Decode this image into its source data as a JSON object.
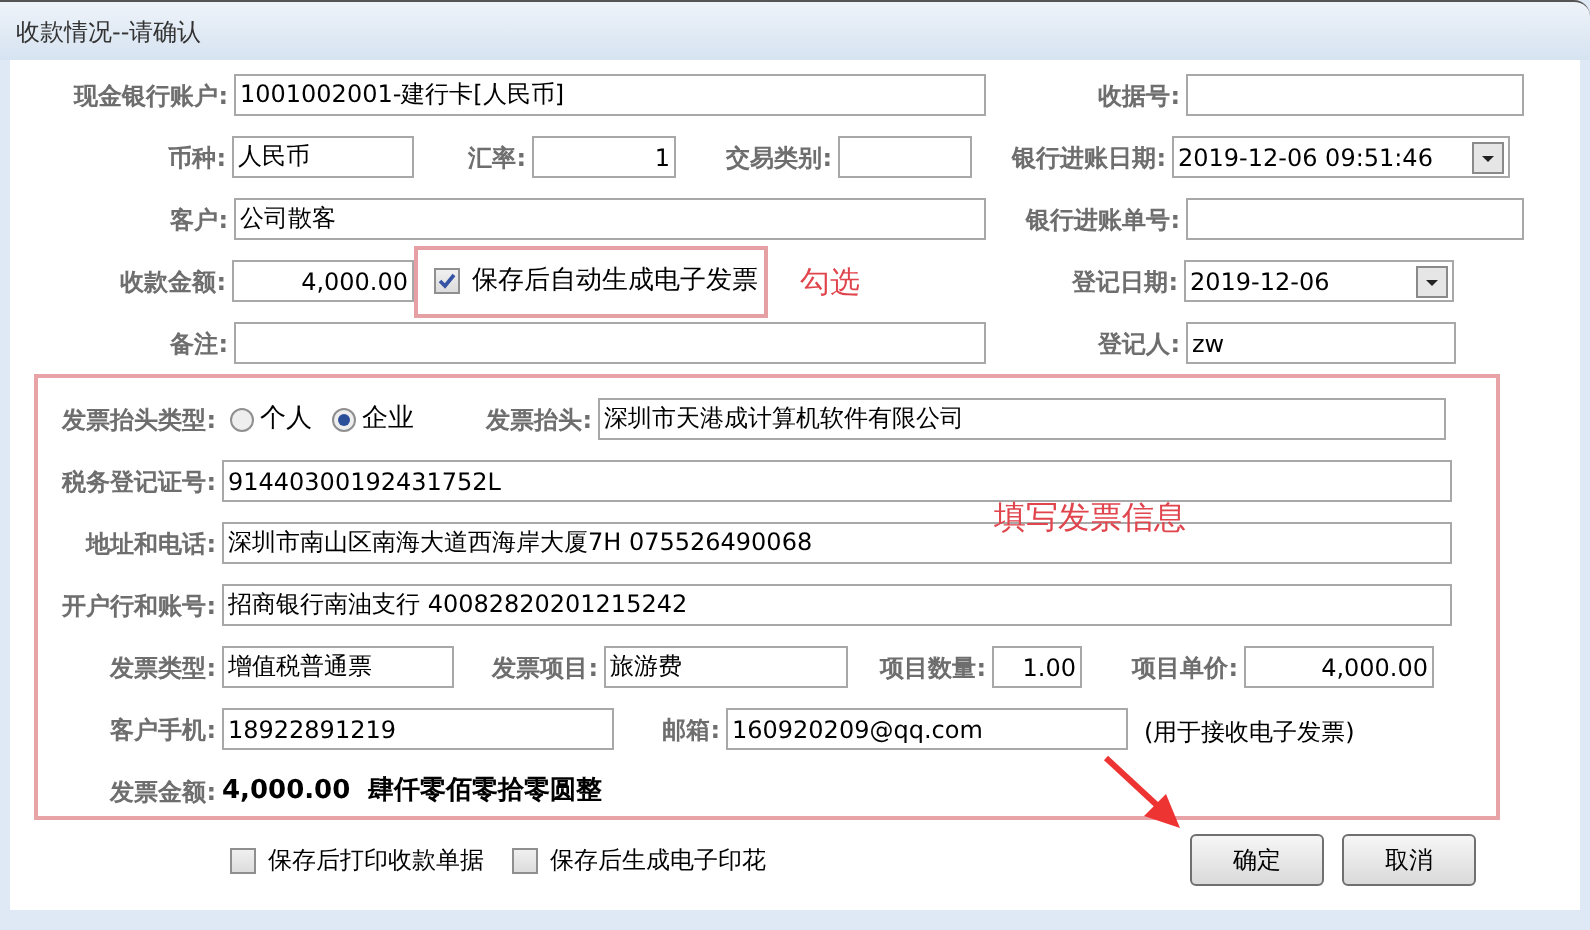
{
  "window": {
    "title": "收款情况--请确认"
  },
  "form": {
    "rows": [
      {
        "items": [
          {
            "kind": "text",
            "label": "现金银行账户:",
            "value": "1001002001-建行卡[人民币]"
          },
          {
            "kind": "text",
            "label": "收据号:"
          }
        ]
      },
      {
        "items": [
          {
            "kind": "text",
            "label": "币种:",
            "value": "人民币"
          },
          {
            "kind": "number",
            "label": "汇率:",
            "value": "1"
          },
          {
            "kind": "text",
            "label": "交易类别:"
          },
          {
            "kind": "dropdown",
            "label": "银行进账日期:",
            "value": "2019-12-06 09:51:46"
          }
        ]
      },
      {
        "items": [
          {
            "kind": "text",
            "label": "客户:",
            "value": "公司散客"
          },
          {
            "kind": "text",
            "label": "银行进账单号:"
          }
        ]
      },
      {
        "items": [
          {
            "kind": "number",
            "label": "收款金额:",
            "value": "4,000.00"
          },
          {
            "kind": "checkbox",
            "label": "保存后自动生成电子发票",
            "checked": true
          },
          {
            "kind": "annotation",
            "label": "勾选"
          },
          {
            "kind": "dropdown",
            "label": "登记日期:",
            "value": "2019-12-06"
          }
        ]
      },
      {
        "items": [
          {
            "kind": "text",
            "label": "备注:"
          },
          {
            "kind": "text",
            "label": "登记人:",
            "value": "zw"
          }
        ]
      }
    ]
  },
  "invoice": {
    "annotation": "填写发票信息",
    "rows": [
      {
        "items": [
          {
            "kind": "radio",
            "label": "发票抬头类型:",
            "options": [
              {
                "label": "个人",
                "selected": false
              },
              {
                "label": "企业",
                "selected": true
              }
            ]
          },
          {
            "kind": "text",
            "label": "发票抬头:",
            "value": "深圳市天港成计算机软件有限公司"
          }
        ]
      },
      {
        "items": [
          {
            "kind": "text",
            "label": "税务登记证号:",
            "value": "91440300192431752L"
          }
        ]
      },
      {
        "items": [
          {
            "kind": "text",
            "label": "地址和电话:",
            "value": "深圳市南山区南海大道西海岸大厦7H 075526490068"
          }
        ]
      },
      {
        "items": [
          {
            "kind": "text",
            "label": "开户行和账号:",
            "value": "招商银行南油支行 40082820201215242"
          }
        ]
      },
      {
        "items": [
          {
            "kind": "text",
            "label": "发票类型:",
            "value": "增值税普通票"
          },
          {
            "kind": "text",
            "label": "发票项目:",
            "value": "旅游费"
          },
          {
            "kind": "number",
            "label": "项目数量:",
            "value": "1.00"
          },
          {
            "kind": "number",
            "label": "项目单价:",
            "value": "4,000.00"
          }
        ]
      },
      {
        "items": [
          {
            "kind": "text",
            "label": "客户手机:",
            "value": "18922891219"
          },
          {
            "kind": "text",
            "label": "邮箱:",
            "value": "160920209@qq.com"
          },
          {
            "kind": "note",
            "label": "(用于接收电子发票)"
          }
        ]
      },
      {
        "items": [
          {
            "kind": "amount",
            "label": "发票金额:",
            "value": "4,000.00  肆仟零佰零拾零圆整"
          }
        ]
      }
    ]
  },
  "options": [
    {
      "label": "保存后打印收款单据",
      "checked": false
    },
    {
      "label": "保存后生成电子印花",
      "checked": false
    }
  ],
  "buttons": [
    "确定",
    "取消"
  ]
}
